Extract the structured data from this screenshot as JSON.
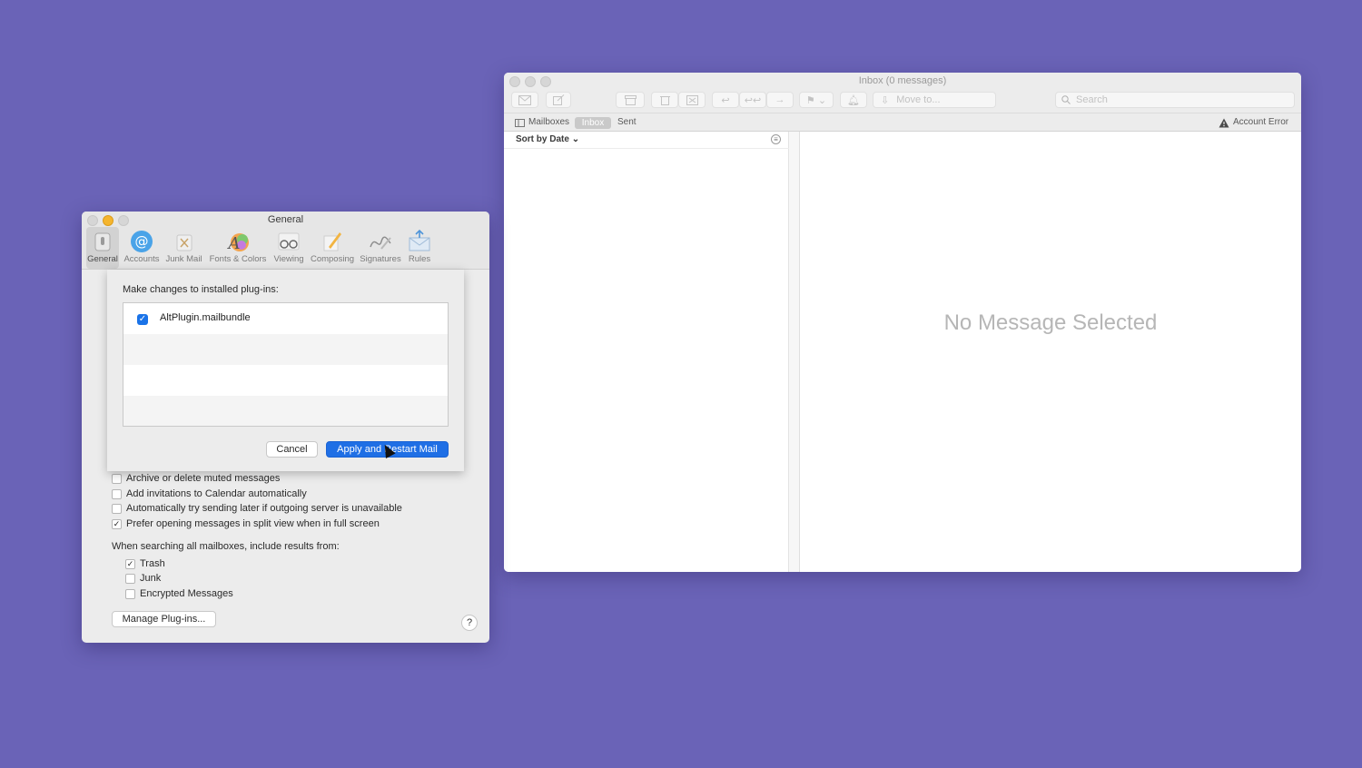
{
  "mail": {
    "title": "Inbox (0 messages)",
    "move_placeholder": "Move to...",
    "search_placeholder": "Search",
    "favorites": {
      "mailboxes": "Mailboxes",
      "inbox": "Inbox",
      "sent": "Sent",
      "account_error": "Account Error"
    },
    "sort_label": "Sort by Date",
    "empty_state": "No Message Selected"
  },
  "prefs": {
    "title": "General",
    "tabs": [
      {
        "label": "General",
        "icon": "general-switch-icon"
      },
      {
        "label": "Accounts",
        "icon": "at-sign-icon"
      },
      {
        "label": "Junk Mail",
        "icon": "trash-x-icon"
      },
      {
        "label": "Fonts & Colors",
        "icon": "font-palette-icon"
      },
      {
        "label": "Viewing",
        "icon": "glasses-icon"
      },
      {
        "label": "Composing",
        "icon": "pencil-note-icon"
      },
      {
        "label": "Signatures",
        "icon": "signature-icon"
      },
      {
        "label": "Rules",
        "icon": "envelope-arrows-icon"
      }
    ],
    "options": [
      {
        "label": "Archive or delete muted messages",
        "checked": false
      },
      {
        "label": "Add invitations to Calendar automatically",
        "checked": false
      },
      {
        "label": "Automatically try sending later if outgoing server is unavailable",
        "checked": false
      },
      {
        "label": "Prefer opening messages in split view when in full screen",
        "checked": true
      }
    ],
    "search_heading": "When searching all mailboxes, include results from:",
    "search_sources": [
      {
        "label": "Trash",
        "checked": true
      },
      {
        "label": "Junk",
        "checked": false
      },
      {
        "label": "Encrypted Messages",
        "checked": false
      }
    ],
    "manage_plugins": "Manage Plug-ins...",
    "help": "?"
  },
  "sheet": {
    "prompt": "Make changes to installed plug-ins:",
    "plugins": [
      {
        "name": "AltPlugin.mailbundle",
        "enabled": true
      }
    ],
    "cancel": "Cancel",
    "apply": "Apply and Restart Mail"
  },
  "colors": {
    "desktop": "#6a63b7",
    "accent": "#1f6fe5"
  }
}
